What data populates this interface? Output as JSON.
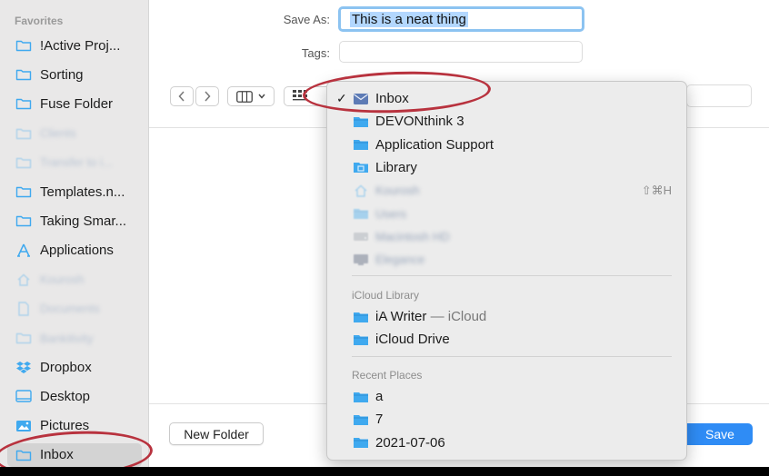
{
  "sidebar": {
    "heading": "Favorites",
    "items": [
      {
        "label": "!Active Proj...",
        "icon": "folder-icon",
        "blurred": false,
        "selected": false
      },
      {
        "label": "Sorting",
        "icon": "folder-icon",
        "blurred": false,
        "selected": false
      },
      {
        "label": "Fuse Folder",
        "icon": "folder-icon",
        "blurred": false,
        "selected": false
      },
      {
        "label": "Clients",
        "icon": "folder-icon",
        "blurred": true,
        "selected": false
      },
      {
        "label": "Transfer to i...",
        "icon": "folder-icon",
        "blurred": true,
        "selected": false
      },
      {
        "label": "Templates.n...",
        "icon": "folder-icon",
        "blurred": false,
        "selected": false
      },
      {
        "label": "Taking Smar...",
        "icon": "folder-icon",
        "blurred": false,
        "selected": false
      },
      {
        "label": "Applications",
        "icon": "applications-icon",
        "blurred": false,
        "selected": false
      },
      {
        "label": "Kourosh",
        "icon": "home-icon",
        "blurred": true,
        "selected": false
      },
      {
        "label": "Documents",
        "icon": "document-icon",
        "blurred": true,
        "selected": false
      },
      {
        "label": "Bankitivity",
        "icon": "folder-icon",
        "blurred": true,
        "selected": false
      },
      {
        "label": "Dropbox",
        "icon": "dropbox-icon",
        "blurred": false,
        "selected": false
      },
      {
        "label": "Desktop",
        "icon": "desktop-icon",
        "blurred": false,
        "selected": false
      },
      {
        "label": "Pictures",
        "icon": "pictures-icon",
        "blurred": false,
        "selected": false
      },
      {
        "label": "Inbox",
        "icon": "folder-icon",
        "blurred": false,
        "selected": true
      }
    ]
  },
  "header": {
    "save_as_label": "Save As:",
    "save_as_value": "This is a neat thing",
    "tags_label": "Tags:"
  },
  "toolbar": {
    "back_icon": "chevron-left-icon",
    "forward_icon": "chevron-right-icon",
    "view_icon": "columns-icon",
    "group_icon": "grid-icon"
  },
  "location_menu": {
    "selected": "Inbox",
    "items": [
      {
        "label": "Inbox",
        "icon": "inbox-icon",
        "checked": true,
        "blurred": false,
        "shortcut": ""
      },
      {
        "label": "DEVONthink 3",
        "icon": "folder-icon",
        "checked": false,
        "blurred": false,
        "shortcut": ""
      },
      {
        "label": "Application Support",
        "icon": "folder-icon",
        "checked": false,
        "blurred": false,
        "shortcut": ""
      },
      {
        "label": "Library",
        "icon": "library-folder-icon",
        "checked": false,
        "blurred": false,
        "shortcut": ""
      },
      {
        "label": "Kourosh",
        "icon": "home-icon",
        "checked": false,
        "blurred": true,
        "shortcut": "⇧⌘H"
      },
      {
        "label": "Users",
        "icon": "folder-icon",
        "checked": false,
        "blurred": true,
        "shortcut": ""
      },
      {
        "label": "Macintosh HD",
        "icon": "disk-icon",
        "checked": false,
        "blurred": true,
        "shortcut": ""
      },
      {
        "label": "Elegance",
        "icon": "computer-icon",
        "checked": false,
        "blurred": true,
        "shortcut": ""
      }
    ],
    "icloud_heading": "iCloud Library",
    "icloud_items": [
      {
        "label": "iA Writer",
        "suffix": " — iCloud",
        "icon": "folder-icon"
      },
      {
        "label": "iCloud Drive",
        "suffix": "",
        "icon": "folder-icon"
      }
    ],
    "recent_heading": "Recent Places",
    "recent_items": [
      {
        "label": "a",
        "icon": "folder-icon"
      },
      {
        "label": "7",
        "icon": "folder-icon"
      },
      {
        "label": "2021-07-06",
        "icon": "folder-icon"
      }
    ]
  },
  "footer": {
    "new_folder_label": "New Folder",
    "save_label": "Save"
  },
  "colors": {
    "accent": "#2f8cf5",
    "folder": "#3fa9ef",
    "annotation": "#b8323e"
  }
}
